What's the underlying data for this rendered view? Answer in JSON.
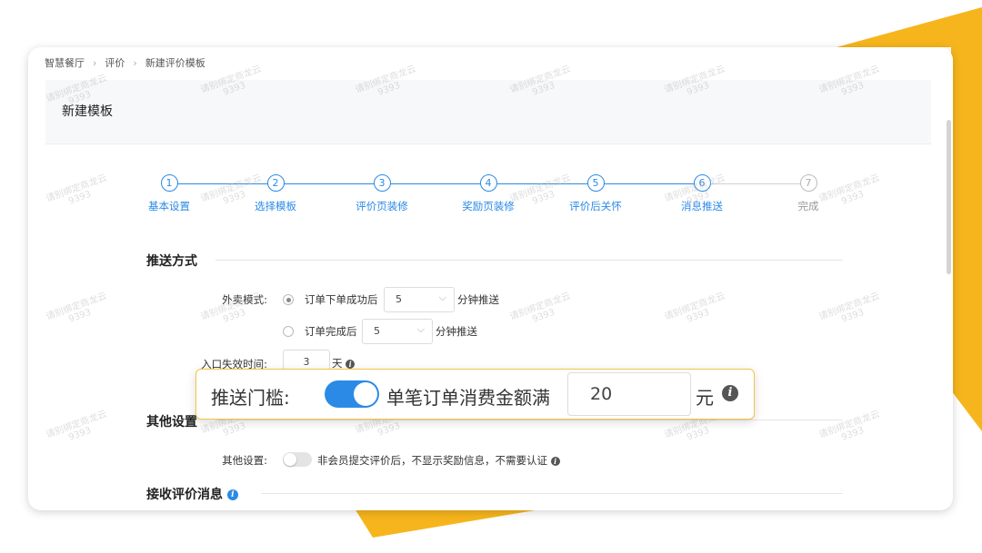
{
  "colors": {
    "accent": "#2b8ae6",
    "highlight_border": "#f5c542",
    "decor_yellow": "#f6b51c"
  },
  "breadcrumb": [
    "智慧餐厅",
    "评价",
    "新建评价模板"
  ],
  "header": {
    "title": "新建模板"
  },
  "steps": [
    {
      "num": "1",
      "label": "基本设置",
      "state": "done"
    },
    {
      "num": "2",
      "label": "选择模板",
      "state": "done"
    },
    {
      "num": "3",
      "label": "评价页装修",
      "state": "done"
    },
    {
      "num": "4",
      "label": "奖励页装修",
      "state": "done"
    },
    {
      "num": "5",
      "label": "评价后关怀",
      "state": "done"
    },
    {
      "num": "6",
      "label": "消息推送",
      "state": "active"
    },
    {
      "num": "7",
      "label": "完成",
      "state": "inactive"
    }
  ],
  "push": {
    "title": "推送方式",
    "takeout_label": "外卖模式:",
    "option1": {
      "text": "订单下单成功后",
      "minutes": "5",
      "suffix": "分钟推送",
      "checked": true
    },
    "option2": {
      "text": "订单完成后",
      "minutes": "5",
      "suffix": "分钟推送",
      "checked": false
    },
    "expire_label": "入口失效时间:",
    "expire_value": "3",
    "expire_unit": "天"
  },
  "threshold": {
    "label": "推送门槛:",
    "enabled": true,
    "text": "单笔订单消费金额满",
    "value": "20",
    "unit": "元"
  },
  "other": {
    "title": "其他设置",
    "label": "其他设置:",
    "toggle_text": "非会员提交评价后，不显示奖励信息，不需要认证"
  },
  "receive": {
    "title": "接收评价消息"
  },
  "watermark": {
    "line1": "请别绑定商龙云",
    "line2": "9393"
  }
}
